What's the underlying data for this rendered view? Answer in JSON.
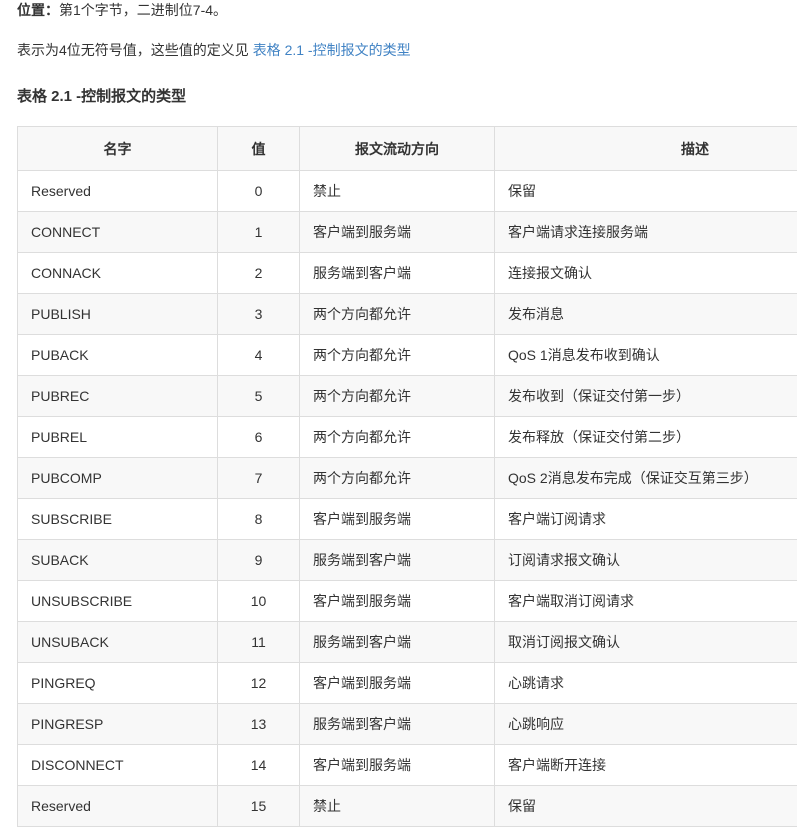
{
  "intro": {
    "position_label": "位置：",
    "position_text": "第1个字节，二进制位7-4。",
    "description_prefix": "表示为4位无符号值，这些值的定义见 ",
    "description_link": "表格 2.1 -控制报文的类型",
    "link_color": "#4183c4"
  },
  "heading": {
    "text": "表格 2.1 -控制报文的类型"
  },
  "table": {
    "headers": {
      "name": "名字",
      "value": "值",
      "direction": "报文流动方向",
      "description": "描述"
    },
    "rows": [
      {
        "name": "Reserved",
        "value": "0",
        "direction": "禁止",
        "description": "保留"
      },
      {
        "name": "CONNECT",
        "value": "1",
        "direction": "客户端到服务端",
        "description": "客户端请求连接服务端"
      },
      {
        "name": "CONNACK",
        "value": "2",
        "direction": "服务端到客户端",
        "description": "连接报文确认"
      },
      {
        "name": "PUBLISH",
        "value": "3",
        "direction": "两个方向都允许",
        "description": "发布消息"
      },
      {
        "name": "PUBACK",
        "value": "4",
        "direction": "两个方向都允许",
        "description": "QoS 1消息发布收到确认"
      },
      {
        "name": "PUBREC",
        "value": "5",
        "direction": "两个方向都允许",
        "description": "发布收到（保证交付第一步）"
      },
      {
        "name": "PUBREL",
        "value": "6",
        "direction": "两个方向都允许",
        "description": "发布释放（保证交付第二步）"
      },
      {
        "name": "PUBCOMP",
        "value": "7",
        "direction": "两个方向都允许",
        "description": "QoS 2消息发布完成（保证交互第三步）"
      },
      {
        "name": "SUBSCRIBE",
        "value": "8",
        "direction": "客户端到服务端",
        "description": "客户端订阅请求"
      },
      {
        "name": "SUBACK",
        "value": "9",
        "direction": "服务端到客户端",
        "description": "订阅请求报文确认"
      },
      {
        "name": "UNSUBSCRIBE",
        "value": "10",
        "direction": "客户端到服务端",
        "description": "客户端取消订阅请求"
      },
      {
        "name": "UNSUBACK",
        "value": "11",
        "direction": "服务端到客户端",
        "description": "取消订阅报文确认"
      },
      {
        "name": "PINGREQ",
        "value": "12",
        "direction": "客户端到服务端",
        "description": "心跳请求"
      },
      {
        "name": "PINGRESP",
        "value": "13",
        "direction": "服务端到客户端",
        "description": "心跳响应"
      },
      {
        "name": "DISCONNECT",
        "value": "14",
        "direction": "客户端到服务端",
        "description": "客户端断开连接"
      },
      {
        "name": "Reserved",
        "value": "15",
        "direction": "禁止",
        "description": "保留"
      }
    ]
  }
}
